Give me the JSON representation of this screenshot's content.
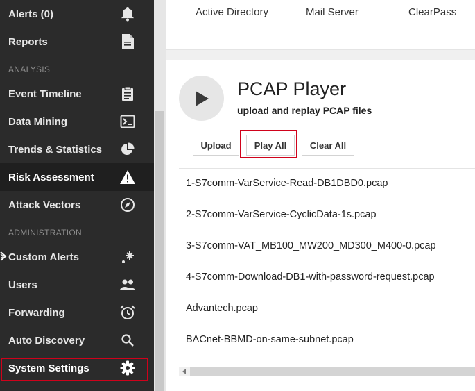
{
  "sidebar": {
    "items": [
      {
        "label": "Alerts (0)",
        "icon": "bell-icon"
      },
      {
        "label": "Reports",
        "icon": "document-icon"
      },
      {
        "label": "Event Timeline",
        "icon": "clipboard-icon"
      },
      {
        "label": "Data Mining",
        "icon": "terminal-icon"
      },
      {
        "label": "Trends & Statistics",
        "icon": "pie-chart-icon"
      },
      {
        "label": "Risk Assessment",
        "icon": "warning-icon"
      },
      {
        "label": "Attack Vectors",
        "icon": "compass-icon"
      },
      {
        "label": "Custom Alerts",
        "icon": "sparkle-icon"
      },
      {
        "label": "Users",
        "icon": "users-icon"
      },
      {
        "label": "Forwarding",
        "icon": "alarm-clock-icon"
      },
      {
        "label": "Auto Discovery",
        "icon": "search-icon"
      },
      {
        "label": "System Settings",
        "icon": "gear-icon"
      }
    ],
    "sections": {
      "analysis": "ANALYSIS",
      "administration": "ADMINISTRATION"
    },
    "active_item": "Risk Assessment"
  },
  "top_tabs": [
    "Active Directory",
    "Mail Server",
    "ClearPass"
  ],
  "pcap": {
    "title": "PCAP Player",
    "subtitle": "upload and replay PCAP files",
    "buttons": {
      "upload": "Upload",
      "play_all": "Play All",
      "clear_all": "Clear All"
    },
    "files": [
      "1-S7comm-VarService-Read-DB1DBD0.pcap",
      "2-S7comm-VarService-CyclicData-1s.pcap",
      "3-S7comm-VAT_MB100_MW200_MD300_M400-0.pcap",
      "4-S7comm-Download-DB1-with-password-request.pcap",
      "Advantech.pcap",
      "BACnet-BBMD-on-same-subnet.pcap"
    ]
  },
  "colors": {
    "sidebar_bg": "#2b2b2b",
    "highlight": "#d0021b"
  }
}
